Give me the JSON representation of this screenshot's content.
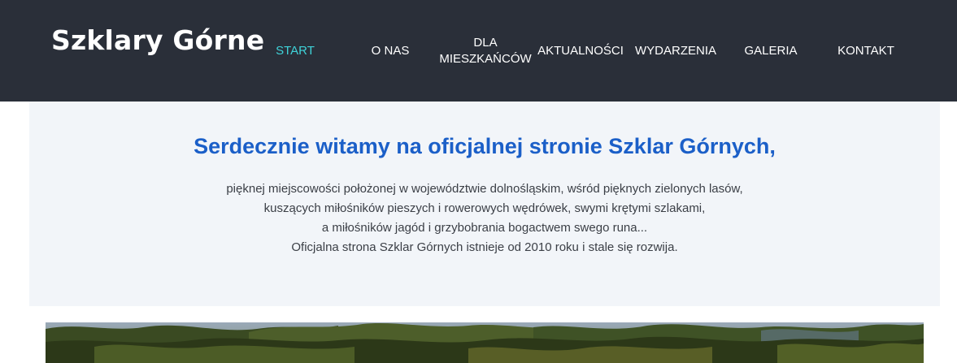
{
  "site": {
    "logo": "Szklary Górne"
  },
  "nav": {
    "items": [
      {
        "label": "START",
        "active": true
      },
      {
        "label": "O NAS",
        "active": false
      },
      {
        "label_line1": "DLA",
        "label_line2": "MIESZKAŃCÓW",
        "active": false
      },
      {
        "label": "AKTUALNOŚCI",
        "active": false
      },
      {
        "label": "WYDARZENIA",
        "active": false
      },
      {
        "label": "GALERIA",
        "active": false
      },
      {
        "label": "KONTAKT",
        "active": false
      }
    ]
  },
  "intro": {
    "title": "Serdecznie witamy na oficjalnej stronie Szklar Górnych,",
    "lines": [
      "pięknej miejscowości położonej w województwie dolnośląskim, wśród pięknych zielonych lasów,",
      "kuszących miłośników pieszych i rowerowych wędrówek, swymi krętymi szlakami,",
      "a miłośników jagód i grzybobrania bogactwem swego runa...",
      "Oficjalna strona Szklar Górnych istnieje od 2010 roku i stale się rozwija."
    ]
  },
  "colors": {
    "header_bg": "#2a2f39",
    "nav_active": "#3fd3d9",
    "title_blue": "#1b5fc8",
    "intro_bg": "#f2f5f9"
  }
}
